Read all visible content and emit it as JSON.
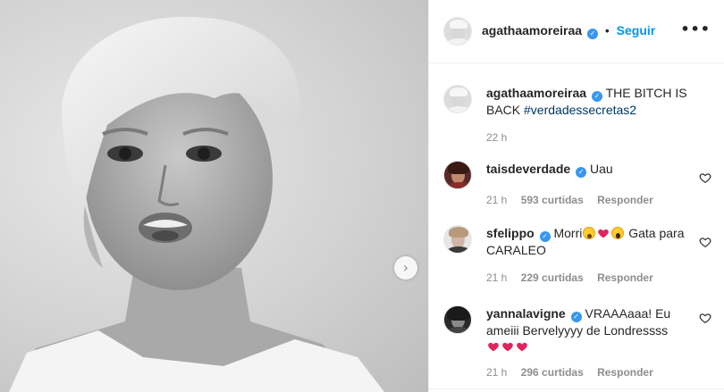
{
  "post": {
    "author": "agathaamoreiraa",
    "follow_label": "Seguir",
    "separator": "•",
    "more_label": "•••",
    "caption": {
      "text": "THE BITCH IS BACK",
      "hashtag": "#verdadessecretas2",
      "time": "22 h"
    },
    "image": {
      "carousel_next_icon": "chevron-right-icon",
      "style": "black-and-white portrait"
    }
  },
  "comments": [
    {
      "user": "taisdeverdade",
      "text": "Uau",
      "time": "21 h",
      "likes": "593 curtidas",
      "reply": "Responder"
    },
    {
      "user": "sfelippo",
      "text_before": "Morri",
      "text_after": "Gata para CARALEO",
      "time": "21 h",
      "likes": "229 curtidas",
      "reply": "Responder"
    },
    {
      "user": "yannalavigne",
      "text": "VRAAAaaa! Eu ameiii Bervelyyyy de Londressss",
      "time": "21 h",
      "likes": "296 curtidas",
      "reply": "Responder"
    }
  ],
  "colors": {
    "accent": "#0095f6",
    "verified": "#3897f0",
    "heart_emoji": "#e0245e",
    "muted": "#8e8e8e"
  }
}
